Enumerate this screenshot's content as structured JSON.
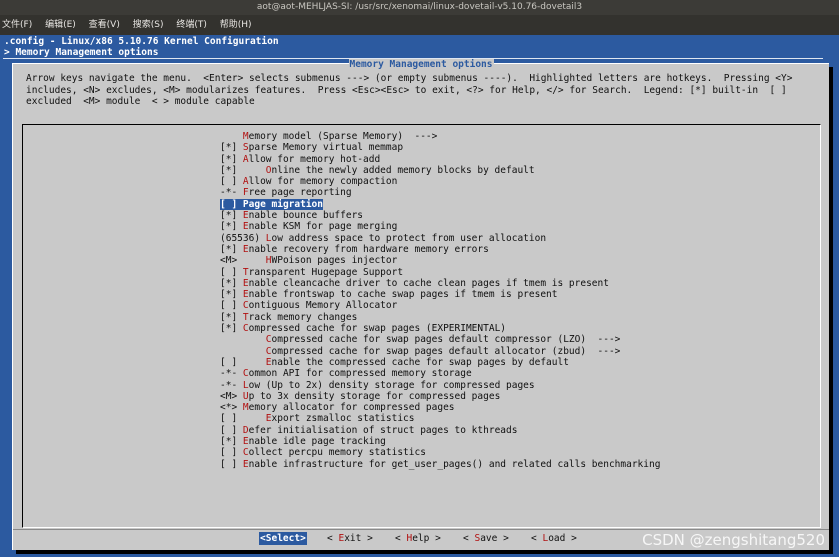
{
  "window": {
    "title": "aot@aot-MEHLJAS-SI: /usr/src/xenomai/linux-dovetail-v5.10.76-dovetail3"
  },
  "menubar": [
    "文件(F)",
    "编辑(E)",
    "查看(V)",
    "搜索(S)",
    "终端(T)",
    "帮助(H)"
  ],
  "config": {
    "title": ".config - Linux/x86 5.10.76 Kernel Configuration",
    "breadcrumb": "> Memory Management options"
  },
  "dialog": {
    "title": "Memory Management options",
    "help_text": "Arrow keys navigate the menu.  <Enter> selects submenus ---> (or empty submenus ----).  Highlighted letters are hotkeys.  Pressing <Y>\nincludes, <N> excludes, <M> modularizes features.  Press <Esc><Esc> to exit, <?> for Help, </> for Search.  Legend: [*] built-in  [ ]\nexcluded  <M> module  < > module capable",
    "items": [
      {
        "prefix": "    ",
        "hot": "M",
        "rest": "emory model (Sparse Memory)  --->",
        "selected": false
      },
      {
        "prefix": "[*] ",
        "hot": "S",
        "rest": "parse Memory virtual memmap",
        "selected": false
      },
      {
        "prefix": "[*] ",
        "hot": "A",
        "rest": "llow for memory hot-add",
        "selected": false
      },
      {
        "prefix": "[*]     ",
        "hot": "O",
        "rest": "nline the newly added memory blocks by default",
        "selected": false
      },
      {
        "prefix": "[ ] ",
        "hot": "A",
        "rest": "llow for memory compaction",
        "selected": false
      },
      {
        "prefix": "-*- ",
        "hot": "F",
        "rest": "ree page reporting",
        "selected": false
      },
      {
        "prefix": "[ ] ",
        "hot": "P",
        "rest": "age migration",
        "selected": true
      },
      {
        "prefix": "[*] ",
        "hot": "E",
        "rest": "nable bounce buffers",
        "selected": false
      },
      {
        "prefix": "[*] ",
        "hot": "E",
        "rest": "nable KSM for page merging",
        "selected": false
      },
      {
        "prefix": "(65536) ",
        "hot": "L",
        "rest": "ow address space to protect from user allocation",
        "selected": false
      },
      {
        "prefix": "[*] ",
        "hot": "E",
        "rest": "nable recovery from hardware memory errors",
        "selected": false
      },
      {
        "prefix": "<M>     ",
        "hot": "H",
        "rest": "WPoison pages injector",
        "selected": false
      },
      {
        "prefix": "[ ] ",
        "hot": "T",
        "rest": "ransparent Hugepage Support",
        "selected": false
      },
      {
        "prefix": "[*] ",
        "hot": "E",
        "rest": "nable cleancache driver to cache clean pages if tmem is present",
        "selected": false
      },
      {
        "prefix": "[*] ",
        "hot": "E",
        "rest": "nable frontswap to cache swap pages if tmem is present",
        "selected": false
      },
      {
        "prefix": "[ ] ",
        "hot": "C",
        "rest": "ontiguous Memory Allocator",
        "selected": false
      },
      {
        "prefix": "[*] ",
        "hot": "T",
        "rest": "rack memory changes",
        "selected": false
      },
      {
        "prefix": "[*] ",
        "hot": "C",
        "rest": "ompressed cache for swap pages (EXPERIMENTAL)",
        "selected": false
      },
      {
        "prefix": "        ",
        "hot": "C",
        "rest": "ompressed cache for swap pages default compressor (LZO)  --->",
        "selected": false
      },
      {
        "prefix": "        ",
        "hot": "C",
        "rest": "ompressed cache for swap pages default allocator (zbud)  --->",
        "selected": false
      },
      {
        "prefix": "[ ]     ",
        "hot": "E",
        "rest": "nable the compressed cache for swap pages by default",
        "selected": false
      },
      {
        "prefix": "-*- ",
        "hot": "C",
        "rest": "ommon API for compressed memory storage",
        "selected": false
      },
      {
        "prefix": "-*- ",
        "hot": "L",
        "rest": "ow (Up to 2x) density storage for compressed pages",
        "selected": false
      },
      {
        "prefix": "<M> ",
        "hot": "U",
        "rest": "p to 3x density storage for compressed pages",
        "selected": false
      },
      {
        "prefix": "<*> ",
        "hot": "M",
        "rest": "emory allocator for compressed pages",
        "selected": false
      },
      {
        "prefix": "[ ]     ",
        "hot": "E",
        "rest": "xport zsmalloc statistics",
        "selected": false
      },
      {
        "prefix": "[ ] ",
        "hot": "D",
        "rest": "efer initialisation of struct pages to kthreads",
        "selected": false
      },
      {
        "prefix": "[*] ",
        "hot": "E",
        "rest": "nable idle page tracking",
        "selected": false
      },
      {
        "prefix": "[ ] ",
        "hot": "C",
        "rest": "ollect percpu memory statistics",
        "selected": false
      },
      {
        "prefix": "[ ] ",
        "hot": "E",
        "rest": "nable infrastructure for get_user_pages() and related calls benchmarking",
        "selected": false
      }
    ],
    "buttons": [
      {
        "open": "<",
        "hot": "S",
        "rest": "elect",
        "close": ">",
        "active": true
      },
      {
        "open": "< ",
        "hot": "E",
        "rest": "xit",
        "close": " >",
        "active": false
      },
      {
        "open": "< ",
        "hot": "H",
        "rest": "elp",
        "close": " >",
        "active": false
      },
      {
        "open": "< ",
        "hot": "S",
        "rest": "ave",
        "close": " >",
        "active": false
      },
      {
        "open": "< ",
        "hot": "L",
        "rest": "oad",
        "close": " >",
        "active": false
      }
    ]
  },
  "watermark": "CSDN @zengshitang520",
  "colors": {
    "terminal_bg": "#2c5aa0",
    "dialog_bg": "#c9c9c9",
    "hotkey": "#b11010",
    "selection": "#2c5aa0"
  }
}
